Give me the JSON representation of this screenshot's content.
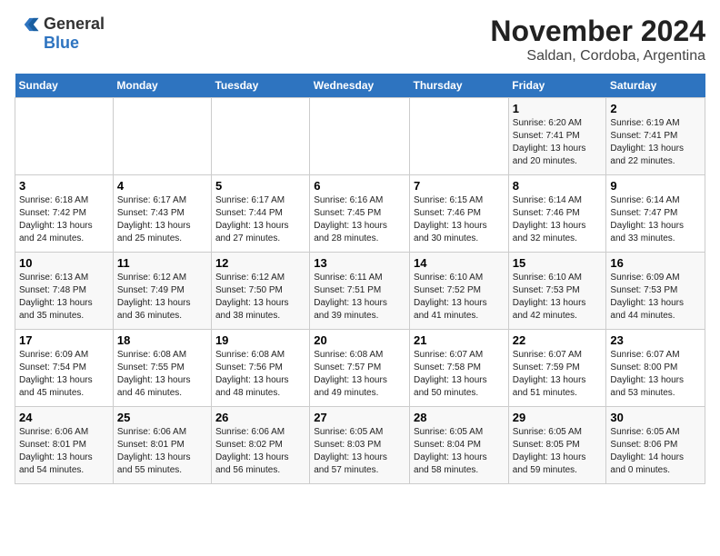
{
  "header": {
    "logo_general": "General",
    "logo_blue": "Blue",
    "month": "November 2024",
    "location": "Saldan, Cordoba, Argentina"
  },
  "weekdays": [
    "Sunday",
    "Monday",
    "Tuesday",
    "Wednesday",
    "Thursday",
    "Friday",
    "Saturday"
  ],
  "weeks": [
    [
      {
        "day": "",
        "info": ""
      },
      {
        "day": "",
        "info": ""
      },
      {
        "day": "",
        "info": ""
      },
      {
        "day": "",
        "info": ""
      },
      {
        "day": "",
        "info": ""
      },
      {
        "day": "1",
        "info": "Sunrise: 6:20 AM\nSunset: 7:41 PM\nDaylight: 13 hours\nand 20 minutes."
      },
      {
        "day": "2",
        "info": "Sunrise: 6:19 AM\nSunset: 7:41 PM\nDaylight: 13 hours\nand 22 minutes."
      }
    ],
    [
      {
        "day": "3",
        "info": "Sunrise: 6:18 AM\nSunset: 7:42 PM\nDaylight: 13 hours\nand 24 minutes."
      },
      {
        "day": "4",
        "info": "Sunrise: 6:17 AM\nSunset: 7:43 PM\nDaylight: 13 hours\nand 25 minutes."
      },
      {
        "day": "5",
        "info": "Sunrise: 6:17 AM\nSunset: 7:44 PM\nDaylight: 13 hours\nand 27 minutes."
      },
      {
        "day": "6",
        "info": "Sunrise: 6:16 AM\nSunset: 7:45 PM\nDaylight: 13 hours\nand 28 minutes."
      },
      {
        "day": "7",
        "info": "Sunrise: 6:15 AM\nSunset: 7:46 PM\nDaylight: 13 hours\nand 30 minutes."
      },
      {
        "day": "8",
        "info": "Sunrise: 6:14 AM\nSunset: 7:46 PM\nDaylight: 13 hours\nand 32 minutes."
      },
      {
        "day": "9",
        "info": "Sunrise: 6:14 AM\nSunset: 7:47 PM\nDaylight: 13 hours\nand 33 minutes."
      }
    ],
    [
      {
        "day": "10",
        "info": "Sunrise: 6:13 AM\nSunset: 7:48 PM\nDaylight: 13 hours\nand 35 minutes."
      },
      {
        "day": "11",
        "info": "Sunrise: 6:12 AM\nSunset: 7:49 PM\nDaylight: 13 hours\nand 36 minutes."
      },
      {
        "day": "12",
        "info": "Sunrise: 6:12 AM\nSunset: 7:50 PM\nDaylight: 13 hours\nand 38 minutes."
      },
      {
        "day": "13",
        "info": "Sunrise: 6:11 AM\nSunset: 7:51 PM\nDaylight: 13 hours\nand 39 minutes."
      },
      {
        "day": "14",
        "info": "Sunrise: 6:10 AM\nSunset: 7:52 PM\nDaylight: 13 hours\nand 41 minutes."
      },
      {
        "day": "15",
        "info": "Sunrise: 6:10 AM\nSunset: 7:53 PM\nDaylight: 13 hours\nand 42 minutes."
      },
      {
        "day": "16",
        "info": "Sunrise: 6:09 AM\nSunset: 7:53 PM\nDaylight: 13 hours\nand 44 minutes."
      }
    ],
    [
      {
        "day": "17",
        "info": "Sunrise: 6:09 AM\nSunset: 7:54 PM\nDaylight: 13 hours\nand 45 minutes."
      },
      {
        "day": "18",
        "info": "Sunrise: 6:08 AM\nSunset: 7:55 PM\nDaylight: 13 hours\nand 46 minutes."
      },
      {
        "day": "19",
        "info": "Sunrise: 6:08 AM\nSunset: 7:56 PM\nDaylight: 13 hours\nand 48 minutes."
      },
      {
        "day": "20",
        "info": "Sunrise: 6:08 AM\nSunset: 7:57 PM\nDaylight: 13 hours\nand 49 minutes."
      },
      {
        "day": "21",
        "info": "Sunrise: 6:07 AM\nSunset: 7:58 PM\nDaylight: 13 hours\nand 50 minutes."
      },
      {
        "day": "22",
        "info": "Sunrise: 6:07 AM\nSunset: 7:59 PM\nDaylight: 13 hours\nand 51 minutes."
      },
      {
        "day": "23",
        "info": "Sunrise: 6:07 AM\nSunset: 8:00 PM\nDaylight: 13 hours\nand 53 minutes."
      }
    ],
    [
      {
        "day": "24",
        "info": "Sunrise: 6:06 AM\nSunset: 8:01 PM\nDaylight: 13 hours\nand 54 minutes."
      },
      {
        "day": "25",
        "info": "Sunrise: 6:06 AM\nSunset: 8:01 PM\nDaylight: 13 hours\nand 55 minutes."
      },
      {
        "day": "26",
        "info": "Sunrise: 6:06 AM\nSunset: 8:02 PM\nDaylight: 13 hours\nand 56 minutes."
      },
      {
        "day": "27",
        "info": "Sunrise: 6:05 AM\nSunset: 8:03 PM\nDaylight: 13 hours\nand 57 minutes."
      },
      {
        "day": "28",
        "info": "Sunrise: 6:05 AM\nSunset: 8:04 PM\nDaylight: 13 hours\nand 58 minutes."
      },
      {
        "day": "29",
        "info": "Sunrise: 6:05 AM\nSunset: 8:05 PM\nDaylight: 13 hours\nand 59 minutes."
      },
      {
        "day": "30",
        "info": "Sunrise: 6:05 AM\nSunset: 8:06 PM\nDaylight: 14 hours\nand 0 minutes."
      }
    ]
  ]
}
